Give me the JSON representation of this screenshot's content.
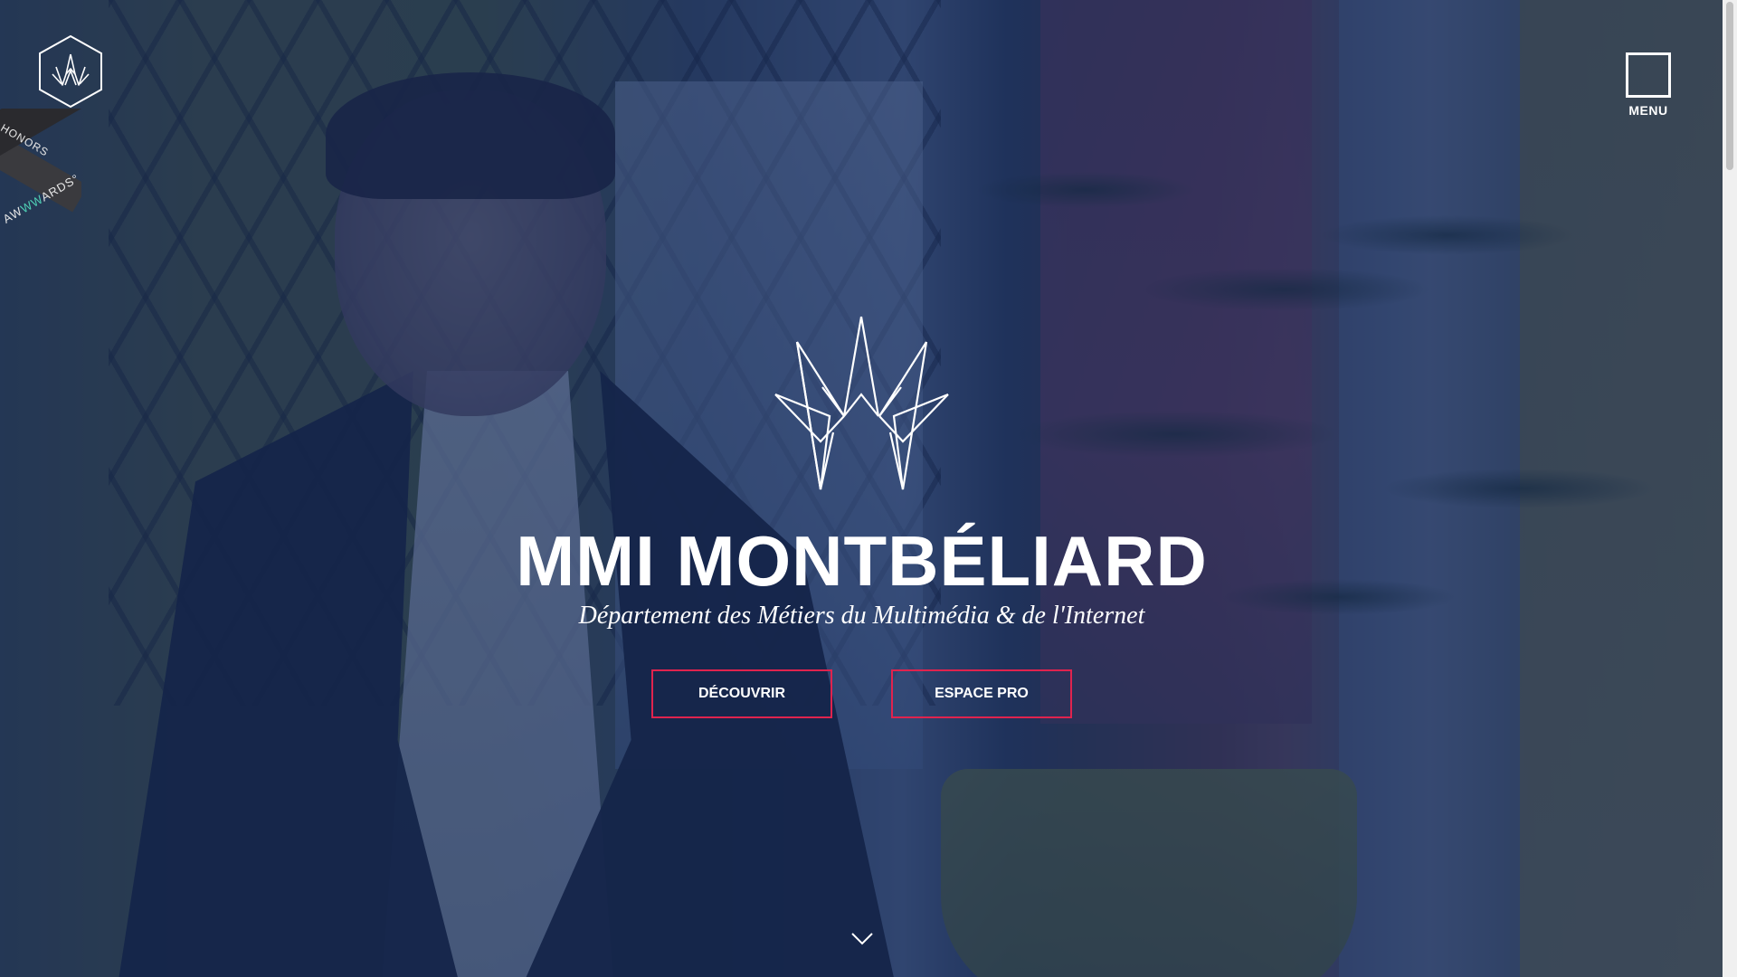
{
  "site": {
    "title": "MMI MONTBÉLIARD",
    "subtitle": "Département des Métiers du Multimédia & de l'Internet"
  },
  "header": {
    "logo_icon": "crown-logo-icon",
    "menu_label": "MENU"
  },
  "award": {
    "honors_label": "HONORS",
    "brand_prefix": "AW",
    "brand_highlight": "WW",
    "brand_suffix": "ARDS°"
  },
  "actions": {
    "discover_label": "DÉCOUVRIR",
    "pro_label": "ESPACE PRO"
  },
  "icons": {
    "scroll": "chevron-down-icon",
    "crown": "crown-icon"
  },
  "colors": {
    "overlay": "#162c5c",
    "accent": "#e0234e",
    "text": "#ffffff"
  }
}
